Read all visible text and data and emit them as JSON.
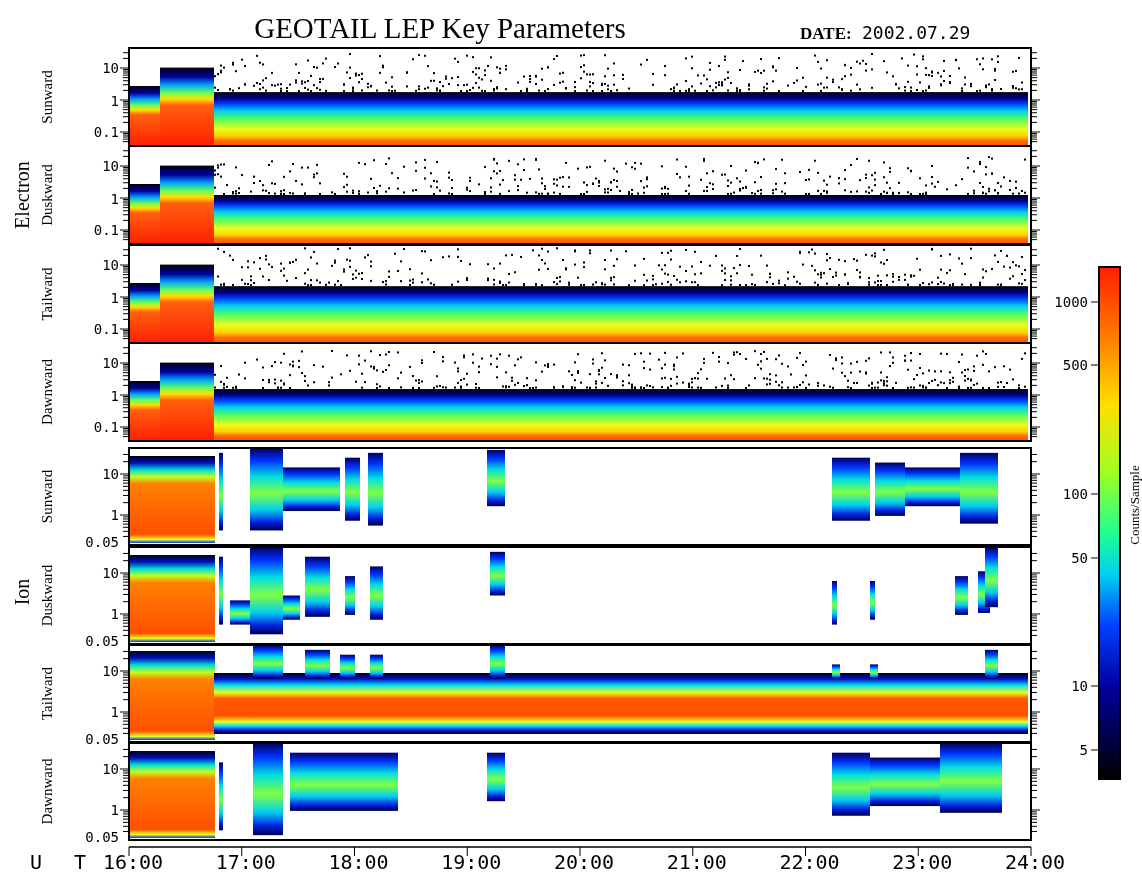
{
  "title": "GEOTAIL LEP Key Parameters",
  "date_label": "DATE:",
  "date": "2002.07.29",
  "groups": [
    {
      "label": "Electron",
      "panels": [
        {
          "direction": "Sunward",
          "yticks": [
            "10",
            "1",
            "0.1"
          ]
        },
        {
          "direction": "Duskward",
          "yticks": [
            "10",
            "1",
            "0.1"
          ]
        },
        {
          "direction": "Tailward",
          "yticks": [
            "10",
            "1",
            "0.1"
          ]
        },
        {
          "direction": "Dawnward",
          "yticks": [
            "10",
            "1",
            "0.1"
          ]
        }
      ]
    },
    {
      "label": "Ion",
      "panels": [
        {
          "direction": "Sunward",
          "yticks": [
            "10",
            "1",
            "0.05"
          ]
        },
        {
          "direction": "Duskward",
          "yticks": [
            "10",
            "1",
            "0.05"
          ]
        },
        {
          "direction": "Tailward",
          "yticks": [
            "10",
            "1",
            "0.05"
          ]
        },
        {
          "direction": "Dawnward",
          "yticks": [
            "10",
            "1",
            "0.05"
          ]
        }
      ]
    }
  ],
  "x_axis": {
    "label": "U T",
    "ticks": [
      "16:00",
      "17:00",
      "18:00",
      "19:00",
      "20:00",
      "21:00",
      "22:00",
      "23:00",
      "24:00"
    ]
  },
  "colorbar": {
    "title": "Counts/Sample",
    "ticks": [
      "1000",
      "500",
      "100",
      "50",
      "10",
      "5"
    ]
  }
}
